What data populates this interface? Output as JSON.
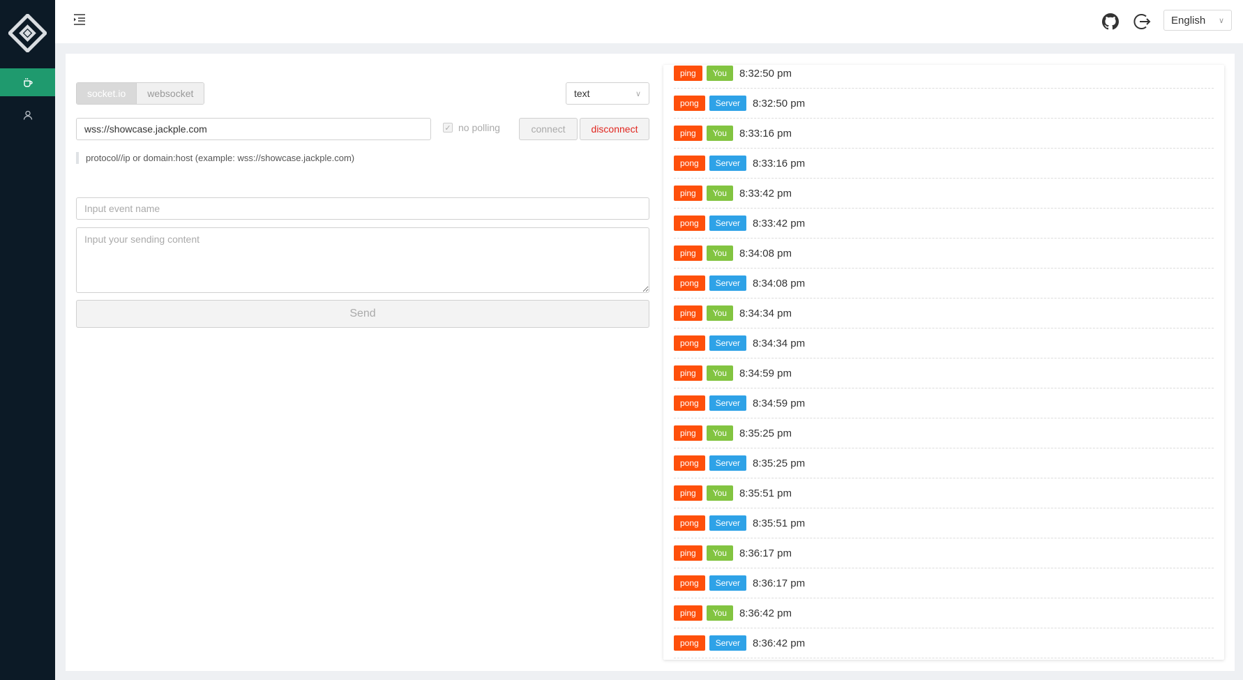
{
  "sidebar": {
    "logo": "logo-icon",
    "items": [
      {
        "icon": "coffee-icon",
        "active": true
      },
      {
        "icon": "user-icon",
        "active": false
      }
    ]
  },
  "header": {
    "menu_icon": "menu-fold-icon",
    "github_icon": "github-icon",
    "logout_icon": "logout-icon",
    "language": "English"
  },
  "form": {
    "protocol_tabs": [
      "socket.io",
      "websocket"
    ],
    "selected_protocol": "socket.io",
    "data_type": "text",
    "url_value": "wss://showcase.jackple.com",
    "no_polling_label": "no polling",
    "no_polling_checked": true,
    "connect_label": "connect",
    "disconnect_label": "disconnect",
    "hint": "protocol//ip or domain:host (example: wss://showcase.jackple.com)",
    "event_placeholder": "Input event name",
    "content_placeholder": "Input your sending content",
    "send_label": "Send"
  },
  "log": [
    {
      "event": "ping",
      "source": "You",
      "time": "8:32:50 pm"
    },
    {
      "event": "pong",
      "source": "Server",
      "time": "8:32:50 pm"
    },
    {
      "event": "ping",
      "source": "You",
      "time": "8:33:16 pm"
    },
    {
      "event": "pong",
      "source": "Server",
      "time": "8:33:16 pm"
    },
    {
      "event": "ping",
      "source": "You",
      "time": "8:33:42 pm"
    },
    {
      "event": "pong",
      "source": "Server",
      "time": "8:33:42 pm"
    },
    {
      "event": "ping",
      "source": "You",
      "time": "8:34:08 pm"
    },
    {
      "event": "pong",
      "source": "Server",
      "time": "8:34:08 pm"
    },
    {
      "event": "ping",
      "source": "You",
      "time": "8:34:34 pm"
    },
    {
      "event": "pong",
      "source": "Server",
      "time": "8:34:34 pm"
    },
    {
      "event": "ping",
      "source": "You",
      "time": "8:34:59 pm"
    },
    {
      "event": "pong",
      "source": "Server",
      "time": "8:34:59 pm"
    },
    {
      "event": "ping",
      "source": "You",
      "time": "8:35:25 pm"
    },
    {
      "event": "pong",
      "source": "Server",
      "time": "8:35:25 pm"
    },
    {
      "event": "ping",
      "source": "You",
      "time": "8:35:51 pm"
    },
    {
      "event": "pong",
      "source": "Server",
      "time": "8:35:51 pm"
    },
    {
      "event": "ping",
      "source": "You",
      "time": "8:36:17 pm"
    },
    {
      "event": "pong",
      "source": "Server",
      "time": "8:36:17 pm"
    },
    {
      "event": "ping",
      "source": "You",
      "time": "8:36:42 pm"
    },
    {
      "event": "pong",
      "source": "Server",
      "time": "8:36:42 pm"
    }
  ],
  "colors": {
    "sidebar_bg": "#0c1a26",
    "sidebar_active": "#1f9a6e",
    "event_badge": "#fe4f0b",
    "you_badge": "#82c441",
    "server_badge": "#2ea2e7",
    "disconnect_text": "#e0261f"
  }
}
